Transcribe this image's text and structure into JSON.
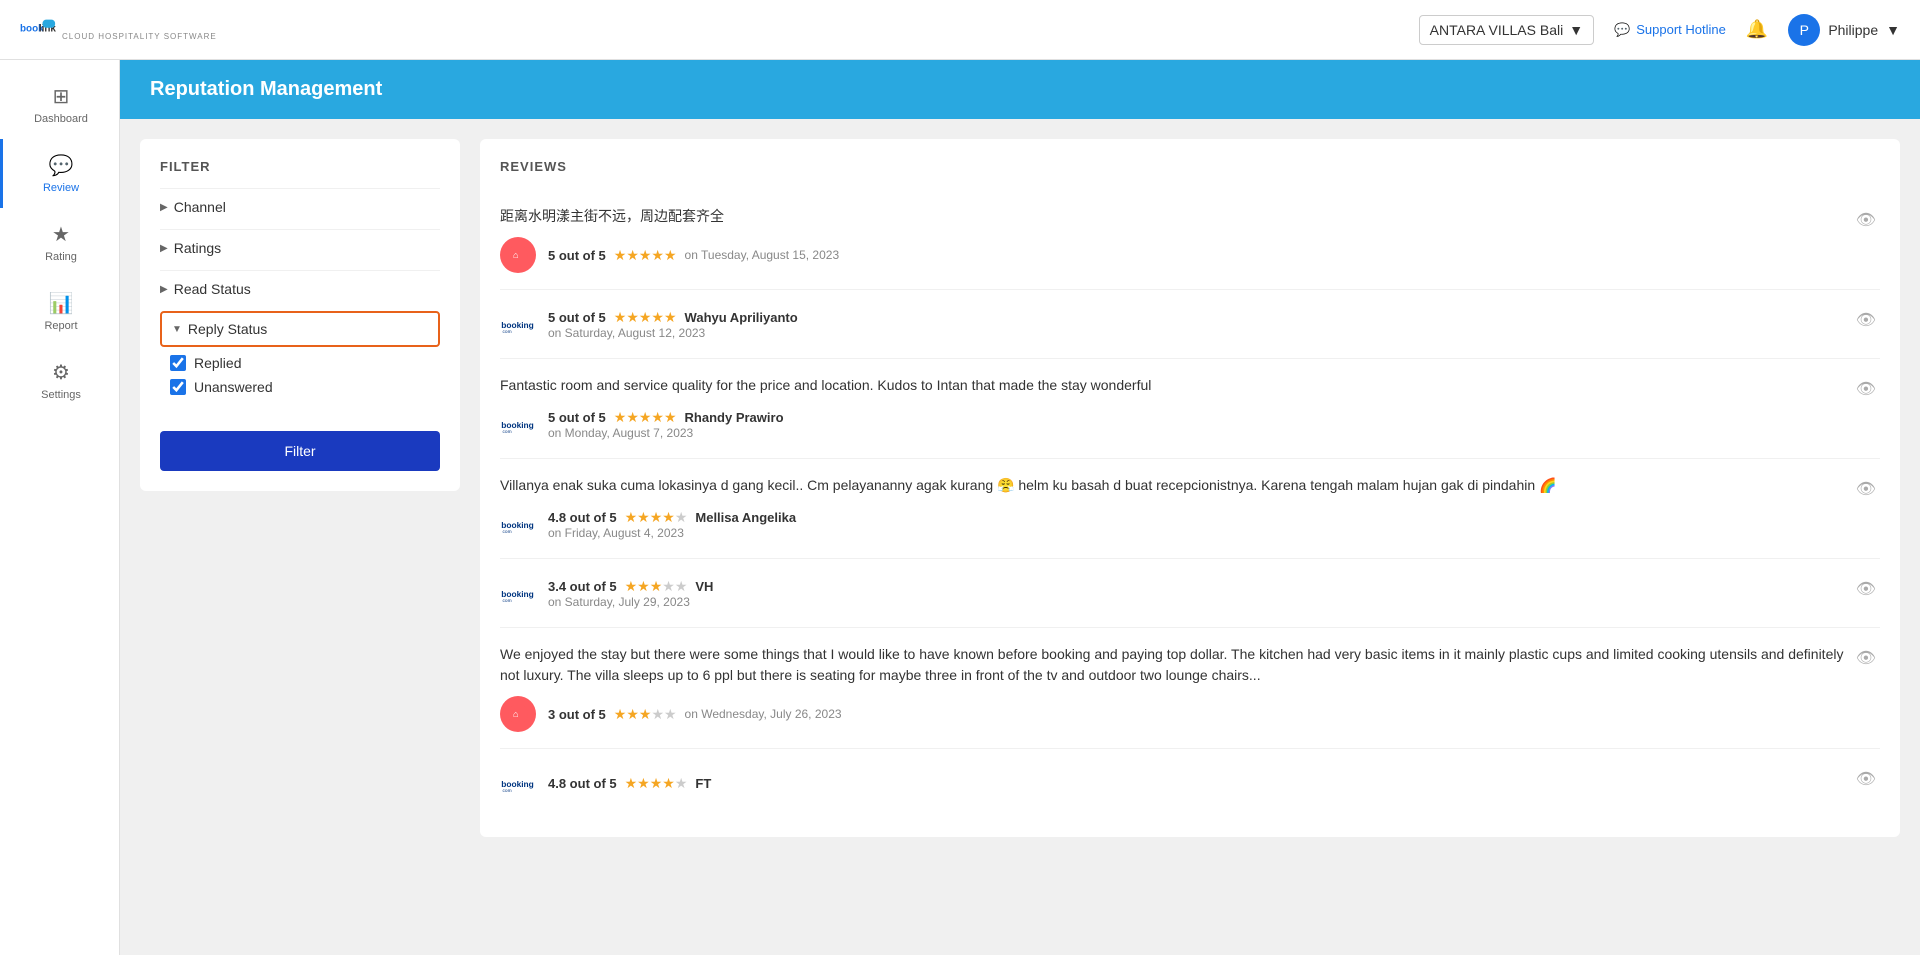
{
  "topNav": {
    "logoText": "book",
    "logoTextBold": "link",
    "logoSub": "CLOUD HOSPITALITY SOFTWARE",
    "hotel": "ANTARA VILLAS Bali",
    "supportHotline": "Support Hotline",
    "bellIcon": "🔔",
    "userName": "Philippe",
    "chevronDown": "▼"
  },
  "sidebar": {
    "items": [
      {
        "id": "dashboard",
        "label": "Dashboard",
        "icon": "⊞"
      },
      {
        "id": "review",
        "label": "Review",
        "icon": "💬",
        "active": true
      },
      {
        "id": "rating",
        "label": "Rating",
        "icon": "★"
      },
      {
        "id": "report",
        "label": "Report",
        "icon": "📊"
      },
      {
        "id": "settings",
        "label": "Settings",
        "icon": "⚙"
      }
    ]
  },
  "pageHeader": {
    "title": "Reputation Management"
  },
  "filter": {
    "sectionTitle": "FILTER",
    "channel": "Channel",
    "ratings": "Ratings",
    "readStatus": "Read Status",
    "replyStatus": "Reply Status",
    "replied": "Replied",
    "unanswered": "Unanswered",
    "filterButton": "Filter"
  },
  "reviews": {
    "sectionTitle": "REVIEWS",
    "items": [
      {
        "id": 1,
        "text": "距离水明漾主街不远，周边配套齐全",
        "score": "5 out of 5",
        "stars": 5,
        "author": "",
        "date": "on Tuesday, August 15, 2023",
        "channel": "airbnb"
      },
      {
        "id": 2,
        "text": "",
        "score": "5 out of 5",
        "stars": 5,
        "author": "Wahyu Apriliyanto",
        "date": "on Saturday, August 12, 2023",
        "channel": "booking"
      },
      {
        "id": 3,
        "text": "Fantastic room and service quality for the price and location. Kudos to Intan that made the stay wonderful",
        "score": "5 out of 5",
        "stars": 5,
        "author": "Rhandy Prawiro",
        "date": "on Monday, August 7, 2023",
        "channel": "booking"
      },
      {
        "id": 4,
        "text": "Villanya enak suka cuma lokasinya d gang kecil.. Cm pelayananny agak kurang 😤 helm ku basah d buat recepcionistnya. Karena tengah malam hujan gak di pindahin 🌈",
        "score": "4.8 out of 5",
        "stars": 4.8,
        "author": "Mellisa Angelika",
        "date": "on Friday, August 4, 2023",
        "channel": "booking"
      },
      {
        "id": 5,
        "text": "",
        "score": "3.4 out of 5",
        "stars": 3.4,
        "author": "VH",
        "date": "on Saturday, July 29, 2023",
        "channel": "booking"
      },
      {
        "id": 6,
        "text": "We enjoyed the stay but there were some things that I would like to have known before booking and paying top dollar. The kitchen had very basic items in it mainly plastic cups and limited cooking utensils and definitely not luxury. The villa sleeps up to 6 ppl but there is seating for maybe three in front of the tv and outdoor two lounge chairs...",
        "score": "3 out of 5",
        "stars": 3,
        "author": "",
        "date": "on Wednesday, July 26, 2023",
        "channel": "airbnb"
      },
      {
        "id": 7,
        "text": "",
        "score": "4.8 out of 5",
        "stars": 4.8,
        "author": "FT",
        "date": "",
        "channel": "booking"
      }
    ]
  }
}
